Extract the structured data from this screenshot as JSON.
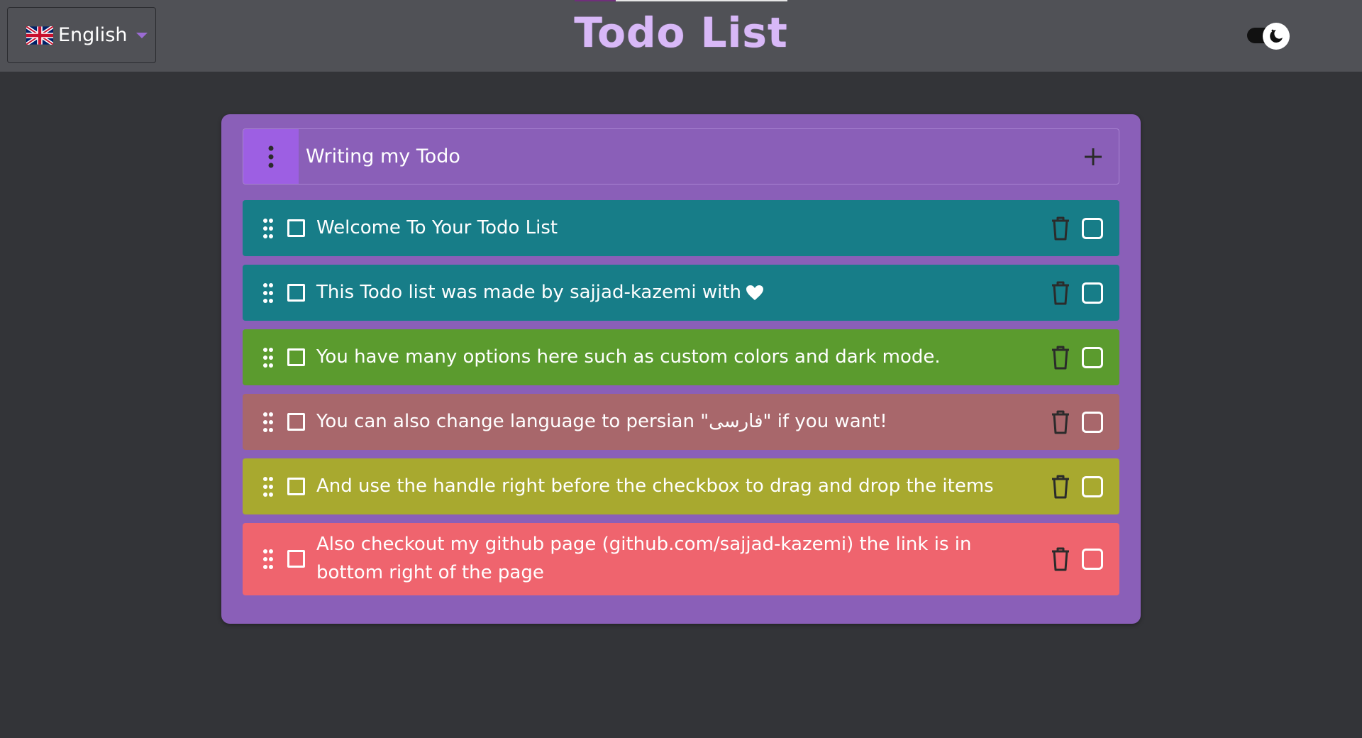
{
  "header": {
    "language": {
      "label": "English",
      "flag_icon": "uk-flag-icon"
    },
    "title": "Todo List",
    "theme_toggle": {
      "icon": "moon-icon",
      "state": "dark"
    }
  },
  "composer": {
    "menu_icon": "vertical-dots-icon",
    "placeholder": "Writing my Todo",
    "add_icon": "plus-icon"
  },
  "todos": [
    {
      "text": "Welcome To Your Todo List",
      "color": "#177d88",
      "completed": false
    },
    {
      "text": "This Todo list was made by sajjad-kazemi with",
      "color": "#177d88",
      "completed": false,
      "suffix_icon": "heart-icon"
    },
    {
      "text": "You have many options here such as custom colors and dark mode.",
      "color": "#5b9b2e",
      "completed": false
    },
    {
      "text": "You can also change language to persian \"فارسی\" if you want!",
      "color": "#a8676b",
      "completed": false
    },
    {
      "text": "And use the handle right before the checkbox to drag and drop the items",
      "color": "#a8a92f",
      "completed": false
    },
    {
      "text": "Also checkout my github page (github.com/sajjad-kazemi) the link is in bottom right of the page",
      "color": "#ef646e",
      "completed": false
    }
  ],
  "colors": {
    "page_bg": "#333438",
    "header_bg": "#505156",
    "card_bg": "#8a5fb8",
    "menu_button_bg": "#9d5fe3",
    "title_color": "#d8b8f7"
  }
}
